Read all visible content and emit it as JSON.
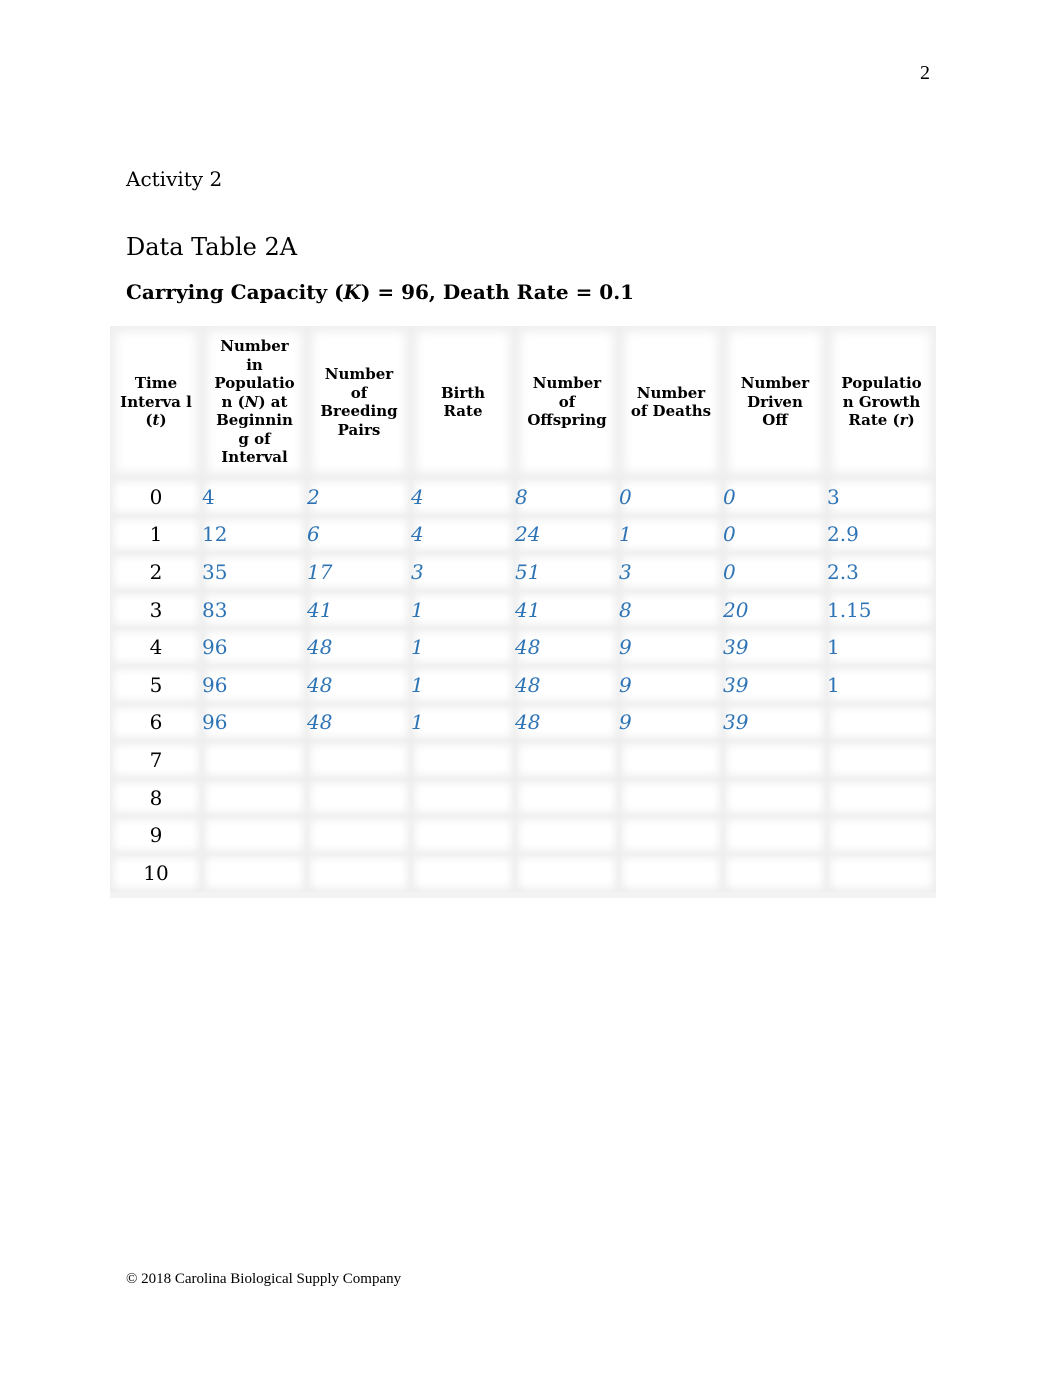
{
  "page": {
    "number": "2",
    "activity": "Activity 2",
    "table_title": "Data Table 2A",
    "subtitle_prefix": "Carrying Capacity (",
    "subtitle_var": "K",
    "subtitle_suffix": ") = 96, Death Rate = 0.1",
    "footer": "© 2018 Carolina Biological Supply Company"
  },
  "table": {
    "headers": [
      {
        "pre": "Time Interva l (",
        "var": "t",
        "post": ")"
      },
      {
        "pre": "Number in Populatio n (",
        "var": "N",
        "post": ") at Beginnin g of Interval"
      },
      {
        "pre": "Number of Breeding Pairs",
        "var": "",
        "post": ""
      },
      {
        "pre": "Birth Rate",
        "var": "",
        "post": ""
      },
      {
        "pre": "Number of Offspring",
        "var": "",
        "post": ""
      },
      {
        "pre": "Number of Deaths",
        "var": "",
        "post": ""
      },
      {
        "pre": "Number Driven Off",
        "var": "",
        "post": ""
      },
      {
        "pre": "Populatio n Growth Rate (",
        "var": "r",
        "post": ")"
      }
    ],
    "rows": [
      {
        "t": "0",
        "n": "4",
        "pairs": "2",
        "birth": "4",
        "offspring": "8",
        "deaths": "0",
        "driven": "0",
        "r": "3"
      },
      {
        "t": "1",
        "n": "12",
        "pairs": "6",
        "birth": "4",
        "offspring": "24",
        "deaths": "1",
        "driven": "0",
        "r": "2.9"
      },
      {
        "t": "2",
        "n": "35",
        "pairs": "17",
        "birth": "3",
        "offspring": "51",
        "deaths": "3",
        "driven": "0",
        "r": "2.3"
      },
      {
        "t": "3",
        "n": "83",
        "pairs": "41",
        "birth": "1",
        "offspring": "41",
        "deaths": "8",
        "driven": "20",
        "r": "1.15"
      },
      {
        "t": "4",
        "n": "96",
        "pairs": "48",
        "birth": "1",
        "offspring": "48",
        "deaths": "9",
        "driven": "39",
        "r": "1"
      },
      {
        "t": "5",
        "n": "96",
        "pairs": "48",
        "birth": "1",
        "offspring": "48",
        "deaths": "9",
        "driven": "39",
        "r": "1"
      },
      {
        "t": "6",
        "n": "96",
        "pairs": "48",
        "birth": "1",
        "offspring": "48",
        "deaths": "9",
        "driven": "39",
        "r": ""
      },
      {
        "t": "7",
        "n": "",
        "pairs": "",
        "birth": "",
        "offspring": "",
        "deaths": "",
        "driven": "",
        "r": ""
      },
      {
        "t": "8",
        "n": "",
        "pairs": "",
        "birth": "",
        "offspring": "",
        "deaths": "",
        "driven": "",
        "r": ""
      },
      {
        "t": "9",
        "n": "",
        "pairs": "",
        "birth": "",
        "offspring": "",
        "deaths": "",
        "driven": "",
        "r": ""
      },
      {
        "t": "10",
        "n": "",
        "pairs": "",
        "birth": "",
        "offspring": "",
        "deaths": "",
        "driven": "",
        "r": ""
      }
    ]
  },
  "colors": {
    "entered_value": "#2e74b5",
    "grid": "#e6e6e6"
  }
}
